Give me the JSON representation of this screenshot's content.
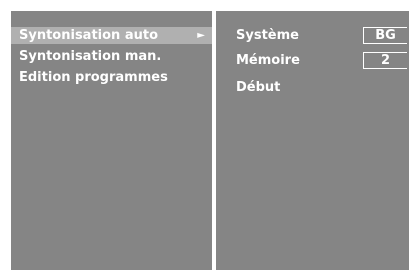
{
  "left_menu": {
    "items": [
      {
        "label": "Syntonisation auto",
        "selected": true,
        "submenu_arrow": "►"
      },
      {
        "label": "Syntonisation man.",
        "selected": false
      },
      {
        "label": "Edition programmes",
        "selected": false
      }
    ]
  },
  "right_panel": {
    "systeme_label": "Système",
    "systeme_value": "BG",
    "memoire_label": "Mémoire",
    "memoire_value": "2",
    "debut_label": "Début"
  },
  "colors": {
    "panel_bg": "#858585",
    "highlight_bg": "#b0b0b0",
    "text": "#ffffff",
    "frame": "#ffffff"
  }
}
